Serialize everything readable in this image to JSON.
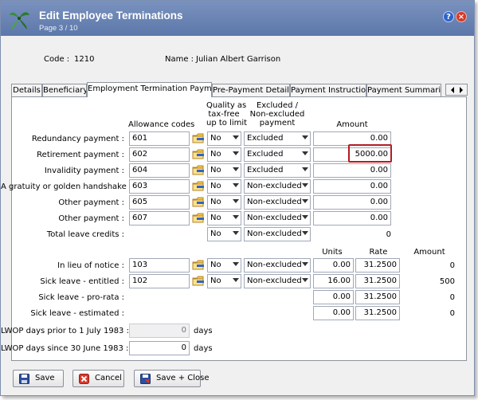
{
  "window": {
    "title": "Edit Employee Terminations",
    "subtitle": "Page 3 / 10",
    "help": "?",
    "close": "×"
  },
  "employee": {
    "code_label": "Code :",
    "code": "1210",
    "name_label": "Name :",
    "name": "Julian Albert Garrison"
  },
  "tabs": [
    "Details",
    "Beneficiary",
    "Employment Termination Payments",
    "Pre-Payment Details",
    "Payment Instructions",
    "Payment Summaries"
  ],
  "active_tab": "Employment Termination Payments",
  "headers": {
    "allowance": "Allowance codes",
    "quality": [
      "Quality as",
      "tax-free",
      "up to limit"
    ],
    "excluded": [
      "Excluded /",
      "Non-excluded",
      "payment"
    ],
    "amount": "Amount",
    "units": "Units",
    "rate": "Rate",
    "amount2": "Amount"
  },
  "payments": [
    {
      "label": "Redundancy payment :",
      "code": "601",
      "quality": "No",
      "excluded": "Excluded",
      "amount": "0.00"
    },
    {
      "label": "Retirement payment :",
      "code": "602",
      "quality": "No",
      "excluded": "Excluded",
      "amount": "5000.00"
    },
    {
      "label": "Invalidity payment :",
      "code": "604",
      "quality": "No",
      "excluded": "Excluded",
      "amount": "0.00"
    },
    {
      "label": "A gratuity or golden handshake :",
      "code": "603",
      "quality": "No",
      "excluded": "Non-excluded",
      "amount": "0.00"
    },
    {
      "label": "Other payment :",
      "code": "605",
      "quality": "No",
      "excluded": "Non-excluded",
      "amount": "0.00"
    },
    {
      "label": "Other payment :",
      "code": "607",
      "quality": "No",
      "excluded": "Non-excluded",
      "amount": "0.00"
    }
  ],
  "total_leave": {
    "label": "Total leave credits :",
    "quality": "No",
    "excluded": "Non-excluded",
    "amount": "0"
  },
  "leave": [
    {
      "label": "In lieu of notice :",
      "code": "103",
      "quality": "No",
      "excluded": "Non-excluded",
      "units": "0.00",
      "rate": "31.2500",
      "amount": "0"
    },
    {
      "label": "Sick leave - entitled :",
      "code": "102",
      "quality": "No",
      "excluded": "Non-excluded",
      "units": "16.00",
      "rate": "31.2500",
      "amount": "500"
    },
    {
      "label": "Sick leave - pro-rata :",
      "units": "0.00",
      "rate": "31.2500",
      "amount": "0"
    },
    {
      "label": "Sick leave - estimated :",
      "units": "0.00",
      "rate": "31.2500",
      "amount": "0"
    }
  ],
  "lwop": [
    {
      "label": "LWOP days prior to 1 July 1983 :",
      "value": "0",
      "unit": "days"
    },
    {
      "label": "LWOP days since 30 June 1983 :",
      "value": "0",
      "unit": "days"
    }
  ],
  "buttons": {
    "save": "Save",
    "cancel": "Cancel",
    "save_close": "Save + Close"
  },
  "colors": {
    "titlebar": "#5c77aa",
    "highlight": "#b31c22",
    "window_bg": "#f0f0f0"
  }
}
